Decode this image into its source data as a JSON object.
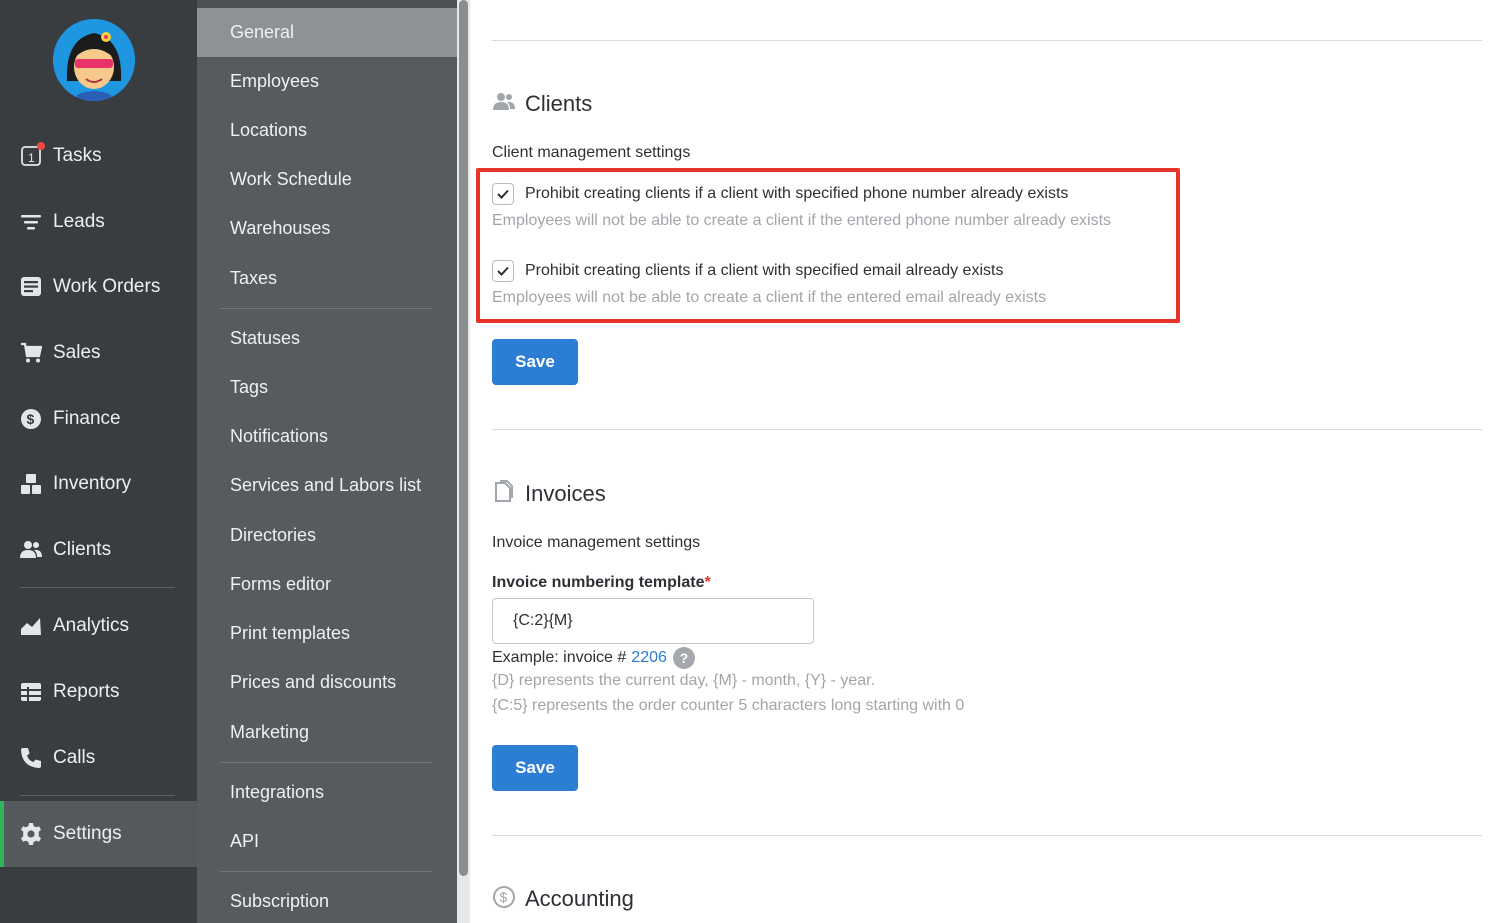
{
  "nav": {
    "items": [
      {
        "label": "Tasks",
        "icon": "tasks-icon"
      },
      {
        "label": "Leads",
        "icon": "filter-icon"
      },
      {
        "label": "Work Orders",
        "icon": "work-orders-icon"
      },
      {
        "label": "Sales",
        "icon": "cart-icon"
      },
      {
        "label": "Finance",
        "icon": "dollar-icon"
      },
      {
        "label": "Inventory",
        "icon": "boxes-icon"
      },
      {
        "label": "Clients",
        "icon": "users-icon"
      },
      {
        "label": "Analytics",
        "icon": "chart-icon"
      },
      {
        "label": "Reports",
        "icon": "reports-icon"
      },
      {
        "label": "Calls",
        "icon": "phone-icon"
      },
      {
        "label": "Settings",
        "icon": "gear-icon"
      }
    ],
    "tasks_badge_count": "1",
    "active": "Settings",
    "accent_color": "#2fb55a"
  },
  "settings_menu": {
    "items": [
      "General",
      "Employees",
      "Locations",
      "Work Schedule",
      "Warehouses",
      "Taxes",
      "Statuses",
      "Tags",
      "Notifications",
      "Services and Labors list",
      "Directories",
      "Forms editor",
      "Print templates",
      "Prices and discounts",
      "Marketing",
      "Integrations",
      "API",
      "Subscription"
    ],
    "active": "General"
  },
  "clients": {
    "title": "Clients",
    "subtitle": "Client management settings",
    "option1_label": "Prohibit creating clients if a client with specified phone number already exists",
    "option1_hint": "Employees will not be able to create a client if the entered phone number already exists",
    "option1_checked": true,
    "option2_label": "Prohibit creating clients if a client with specified email already exists",
    "option2_hint": "Employees will not be able to create a client if the entered email already exists",
    "option2_checked": true,
    "save_label": "Save"
  },
  "invoices": {
    "title": "Invoices",
    "subtitle": "Invoice management settings",
    "field_label": "Invoice numbering template",
    "required_mark": "*",
    "field_value": "{C:2}{M}",
    "example_prefix": "Example: invoice #",
    "example_number": "2206",
    "help_glyph": "?",
    "hint1": "{D} represents the current day, {M} - month, {Y} - year.",
    "hint2": "{C:5} represents the order counter 5 characters long starting with 0",
    "save_label": "Save"
  },
  "accounting": {
    "title": "Accounting"
  },
  "colors": {
    "primary": "#2b7ed3",
    "highlight_border": "#e8332b"
  }
}
